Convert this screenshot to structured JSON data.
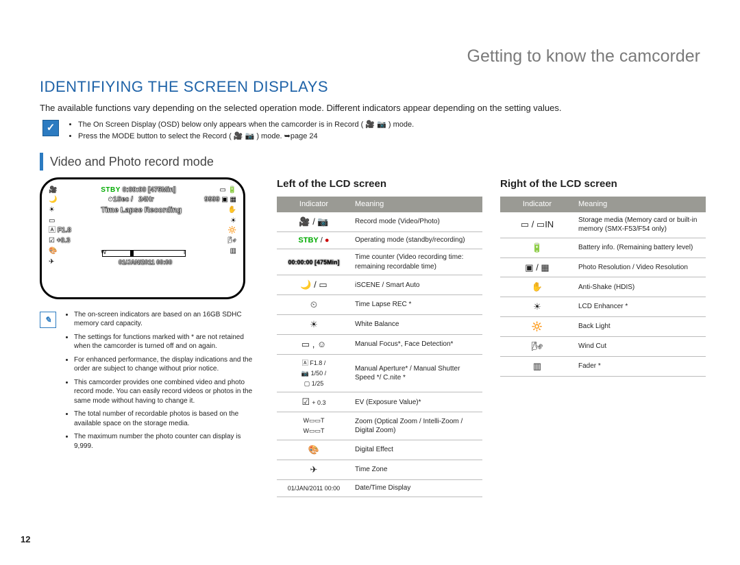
{
  "page_number": "12",
  "section": "Getting to know the camcorder",
  "title": "IDENTIFIYING THE SCREEN DISPLAYS",
  "intro": "The available functions vary depending on the selected operation mode. Different indicators appear depending on the setting values.",
  "top_notes": {
    "items": [
      "The On Screen Display (OSD) below only appears when the camcorder is in Record ( 🎥 📷 ) mode.",
      "Press the MODE button to select the Record ( 🎥 📷 ) mode. ➥page 24"
    ]
  },
  "mode_heading": "Video and Photo record mode",
  "lcd": {
    "stby": "STBY",
    "time": "0:00:00",
    "remain": "[475Min]",
    "interval": "1Sec /",
    "hr": "24Hr",
    "count": "9999",
    "tlr": "Time Lapse Recording",
    "f": "F1.8",
    "ev": "+0.3",
    "date": "01/JAN/2011 00:00"
  },
  "left_notes": {
    "items": [
      "The on-screen indicators are based on an 16GB SDHC memory card capacity.",
      "The settings for functions marked with * are not retained when the camcorder is turned off and on again.",
      "For enhanced performance, the display indications and the order are subject to change without prior notice.",
      "This camcorder provides one combined video and photo record mode. You can easily record videos or photos in the same mode without having to change it.",
      "The total number of recordable photos is based on the available space on the storage media.",
      "The maximum number the photo counter can display is 9,999."
    ]
  },
  "left_table": {
    "heading": "Left of the LCD screen",
    "cols": {
      "a": "Indicator",
      "b": "Meaning"
    },
    "rows": [
      {
        "ind_html": "<span class='glyph'>🎥 / 📷</span>",
        "mean": "Record mode (Video/Photo)"
      },
      {
        "ind_html": "<span class='green'>STBY</span> / <span class='red'>●</span>",
        "mean": "Operating mode (standby/recording)"
      },
      {
        "ind_html": "<span class='small outline' style='color:#000;-webkit-text-stroke:0'>00:00:00 [475Min]</span>",
        "mean": "Time counter (Video recording time: remaining recordable time)"
      },
      {
        "ind_html": "<span class='glyph'>🌙 / ▭</span>",
        "mean": "iSCENE / Smart Auto"
      },
      {
        "ind_html": "<span class='glyph'>⏲</span>",
        "mean": "Time Lapse REC *"
      },
      {
        "ind_html": "<span class='glyph'>☀</span>",
        "mean": "White Balance"
      },
      {
        "ind_html": "<span class='glyph'>▭ , ☺</span>",
        "mean": "Manual Focus*, Face Detection*"
      },
      {
        "ind_html": "<span class='small'>🄰 F1.8 /<br>📷 1/50 /<br>▢ 1/25</span>",
        "mean": "Manual Aperture* / Manual Shutter Speed */ C.nite *"
      },
      {
        "ind_html": "<span class='glyph'>☑</span> <span class='small'>+ 0.3</span>",
        "mean": "EV (Exposure Value)*"
      },
      {
        "ind_html": "<span class='small'>W▭▭T<br>W▭▭T</span>",
        "mean": "Zoom (Optical Zoom / Intelli-Zoom / Digital Zoom)"
      },
      {
        "ind_html": "<span class='glyph'>🎨</span>",
        "mean": "Digital Effect"
      },
      {
        "ind_html": "<span class='glyph'>✈</span>",
        "mean": "Time Zone"
      },
      {
        "ind_html": "<span class='small'>01/JAN/2011 00:00</span>",
        "mean": "Date/Time Display"
      }
    ]
  },
  "right_table": {
    "heading": "Right of the LCD screen",
    "cols": {
      "a": "Indicator",
      "b": "Meaning"
    },
    "rows": [
      {
        "ind_html": "<span class='glyph'>▭ / ▭IN</span>",
        "mean": "Storage media (Memory card or built-in memory (SMX-F53/F54 only)"
      },
      {
        "ind_html": "<span class='glyph'>🔋</span>",
        "mean": "Battery info. (Remaining battery level)"
      },
      {
        "ind_html": "<span class='glyph'>▣ / ▦</span>",
        "mean": "Photo Resolution / Video Resolution"
      },
      {
        "ind_html": "<span class='glyph'>✋</span>",
        "mean": "Anti-Shake (HDIS)"
      },
      {
        "ind_html": "<span class='glyph'>☀</span>",
        "mean": "LCD Enhancer *"
      },
      {
        "ind_html": "<span class='glyph'>🔆</span>",
        "mean": "Back Light"
      },
      {
        "ind_html": "<span class='glyph'>🌬</span>",
        "mean": "Wind Cut"
      },
      {
        "ind_html": "<span class='glyph'>▥</span>",
        "mean": "Fader *"
      }
    ]
  }
}
